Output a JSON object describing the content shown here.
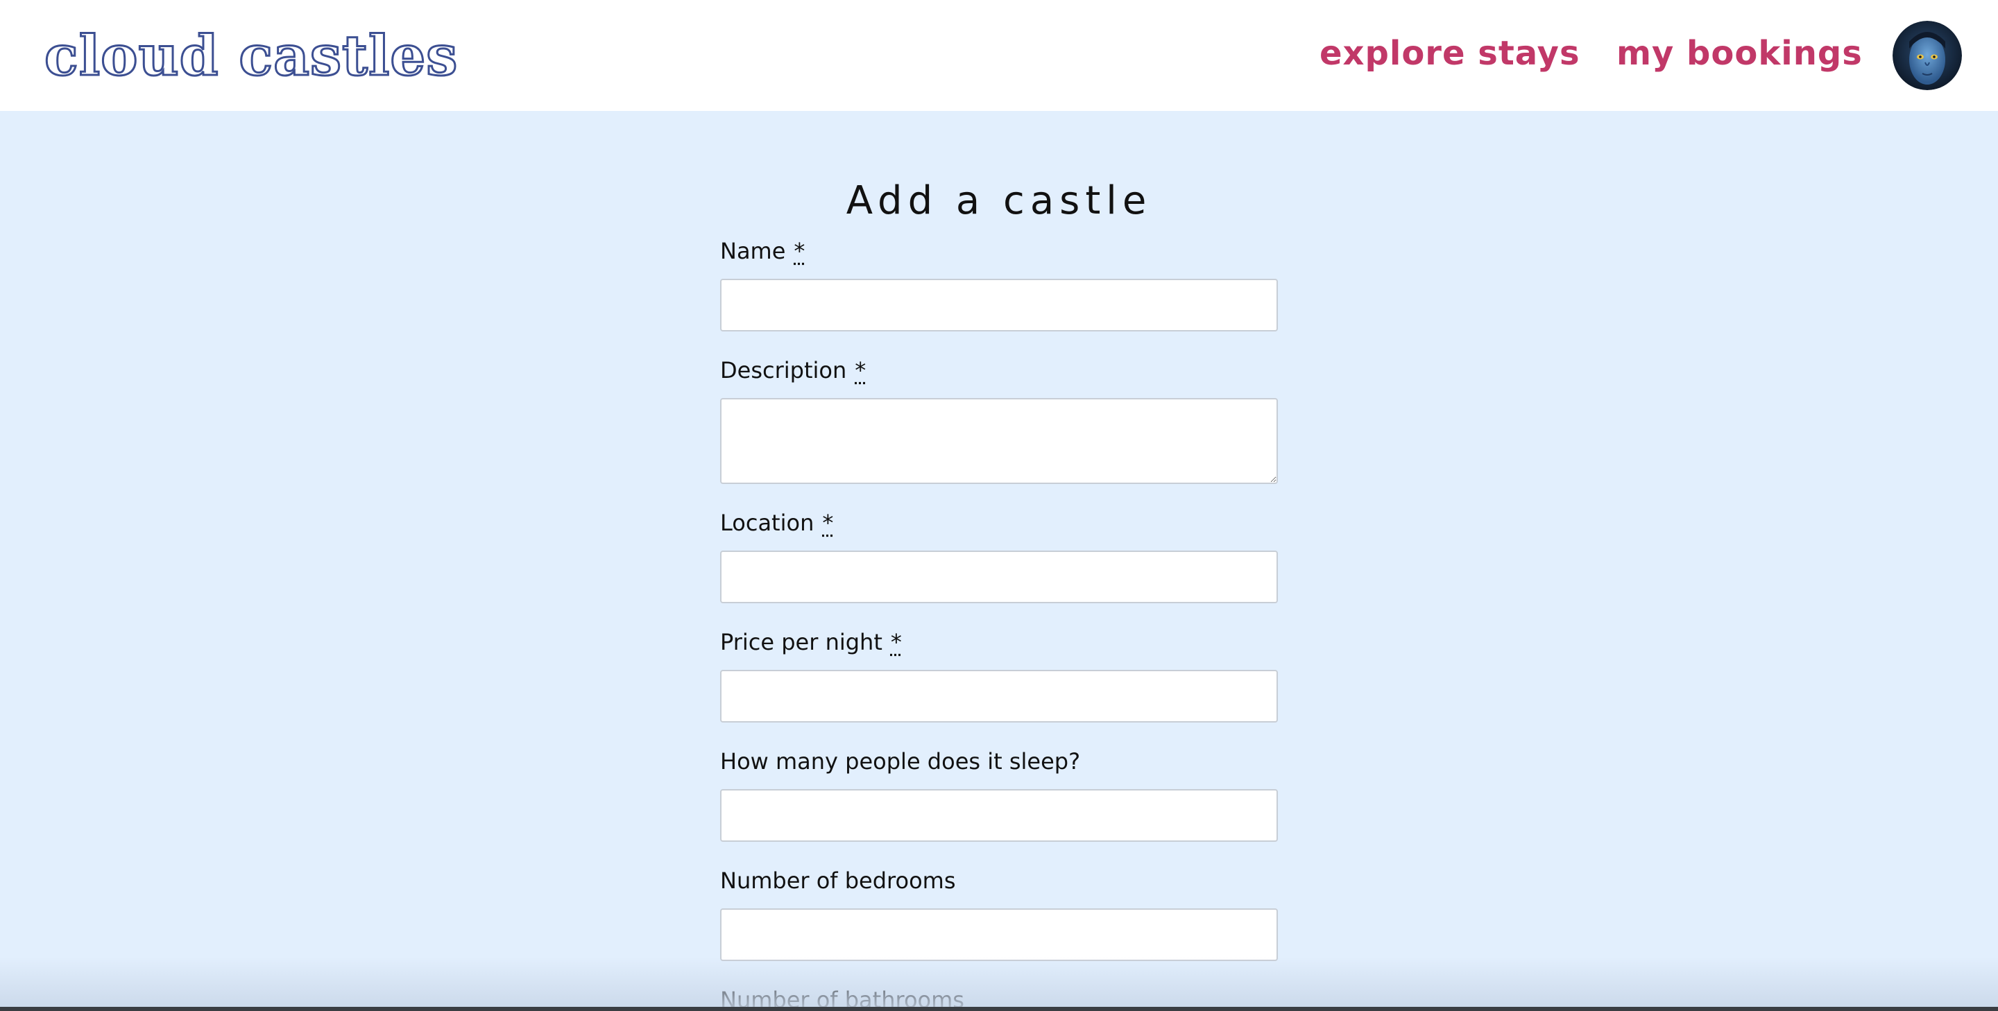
{
  "header": {
    "brand": "cloud castles",
    "nav": {
      "explore": "explore stays",
      "bookings": "my bookings"
    },
    "avatar_icon": "user-avatar-icon"
  },
  "form": {
    "title": "Add a castle",
    "required_marker": "*",
    "fields": {
      "name": {
        "label": "Name",
        "value": ""
      },
      "description": {
        "label": "Description",
        "value": ""
      },
      "location": {
        "label": "Location",
        "value": ""
      },
      "price": {
        "label": "Price per night",
        "value": ""
      },
      "sleeps": {
        "label": "How many people does it sleep?",
        "value": ""
      },
      "bedrooms": {
        "label": "Number of bedrooms",
        "value": ""
      },
      "bathrooms": {
        "label": "Number of bathrooms"
      }
    }
  },
  "colors": {
    "page_background": "#e2effd",
    "brand": "#3c4f92",
    "nav_link": "#c13868",
    "header_background": "#ffffff"
  }
}
